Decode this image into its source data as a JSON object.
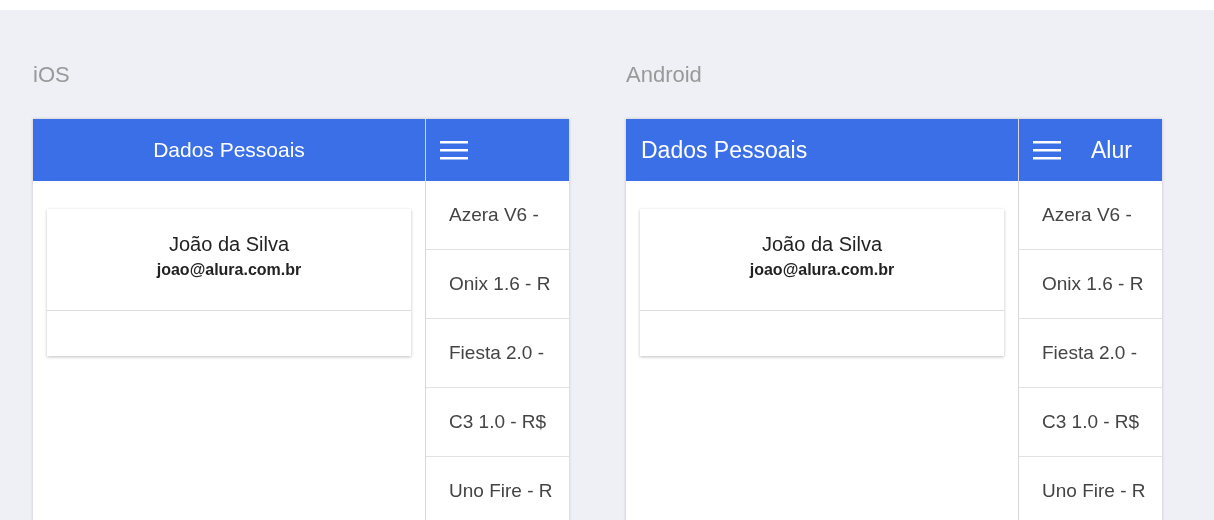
{
  "panels": [
    {
      "label": "iOS",
      "kind": "ios",
      "header": {
        "title": "Dados Pessoais"
      },
      "card": {
        "name": "João da Silva",
        "email": "joao@alura.com.br"
      },
      "drawer": {
        "items": [
          "Azera V6 -",
          "Onix 1.6 - R",
          "Fiesta 2.0 -",
          "C3 1.0 - R$",
          "Uno Fire - R"
        ]
      }
    },
    {
      "label": "Android",
      "kind": "android",
      "header": {
        "title": "Dados Pessoais"
      },
      "card": {
        "name": "João da Silva",
        "email": "joao@alura.com.br"
      },
      "drawer": {
        "title": "Alur",
        "items": [
          "Azera V6 -",
          "Onix 1.6 - R",
          "Fiesta 2.0 -",
          "C3 1.0 - R$",
          "Uno Fire - R"
        ]
      }
    }
  ]
}
